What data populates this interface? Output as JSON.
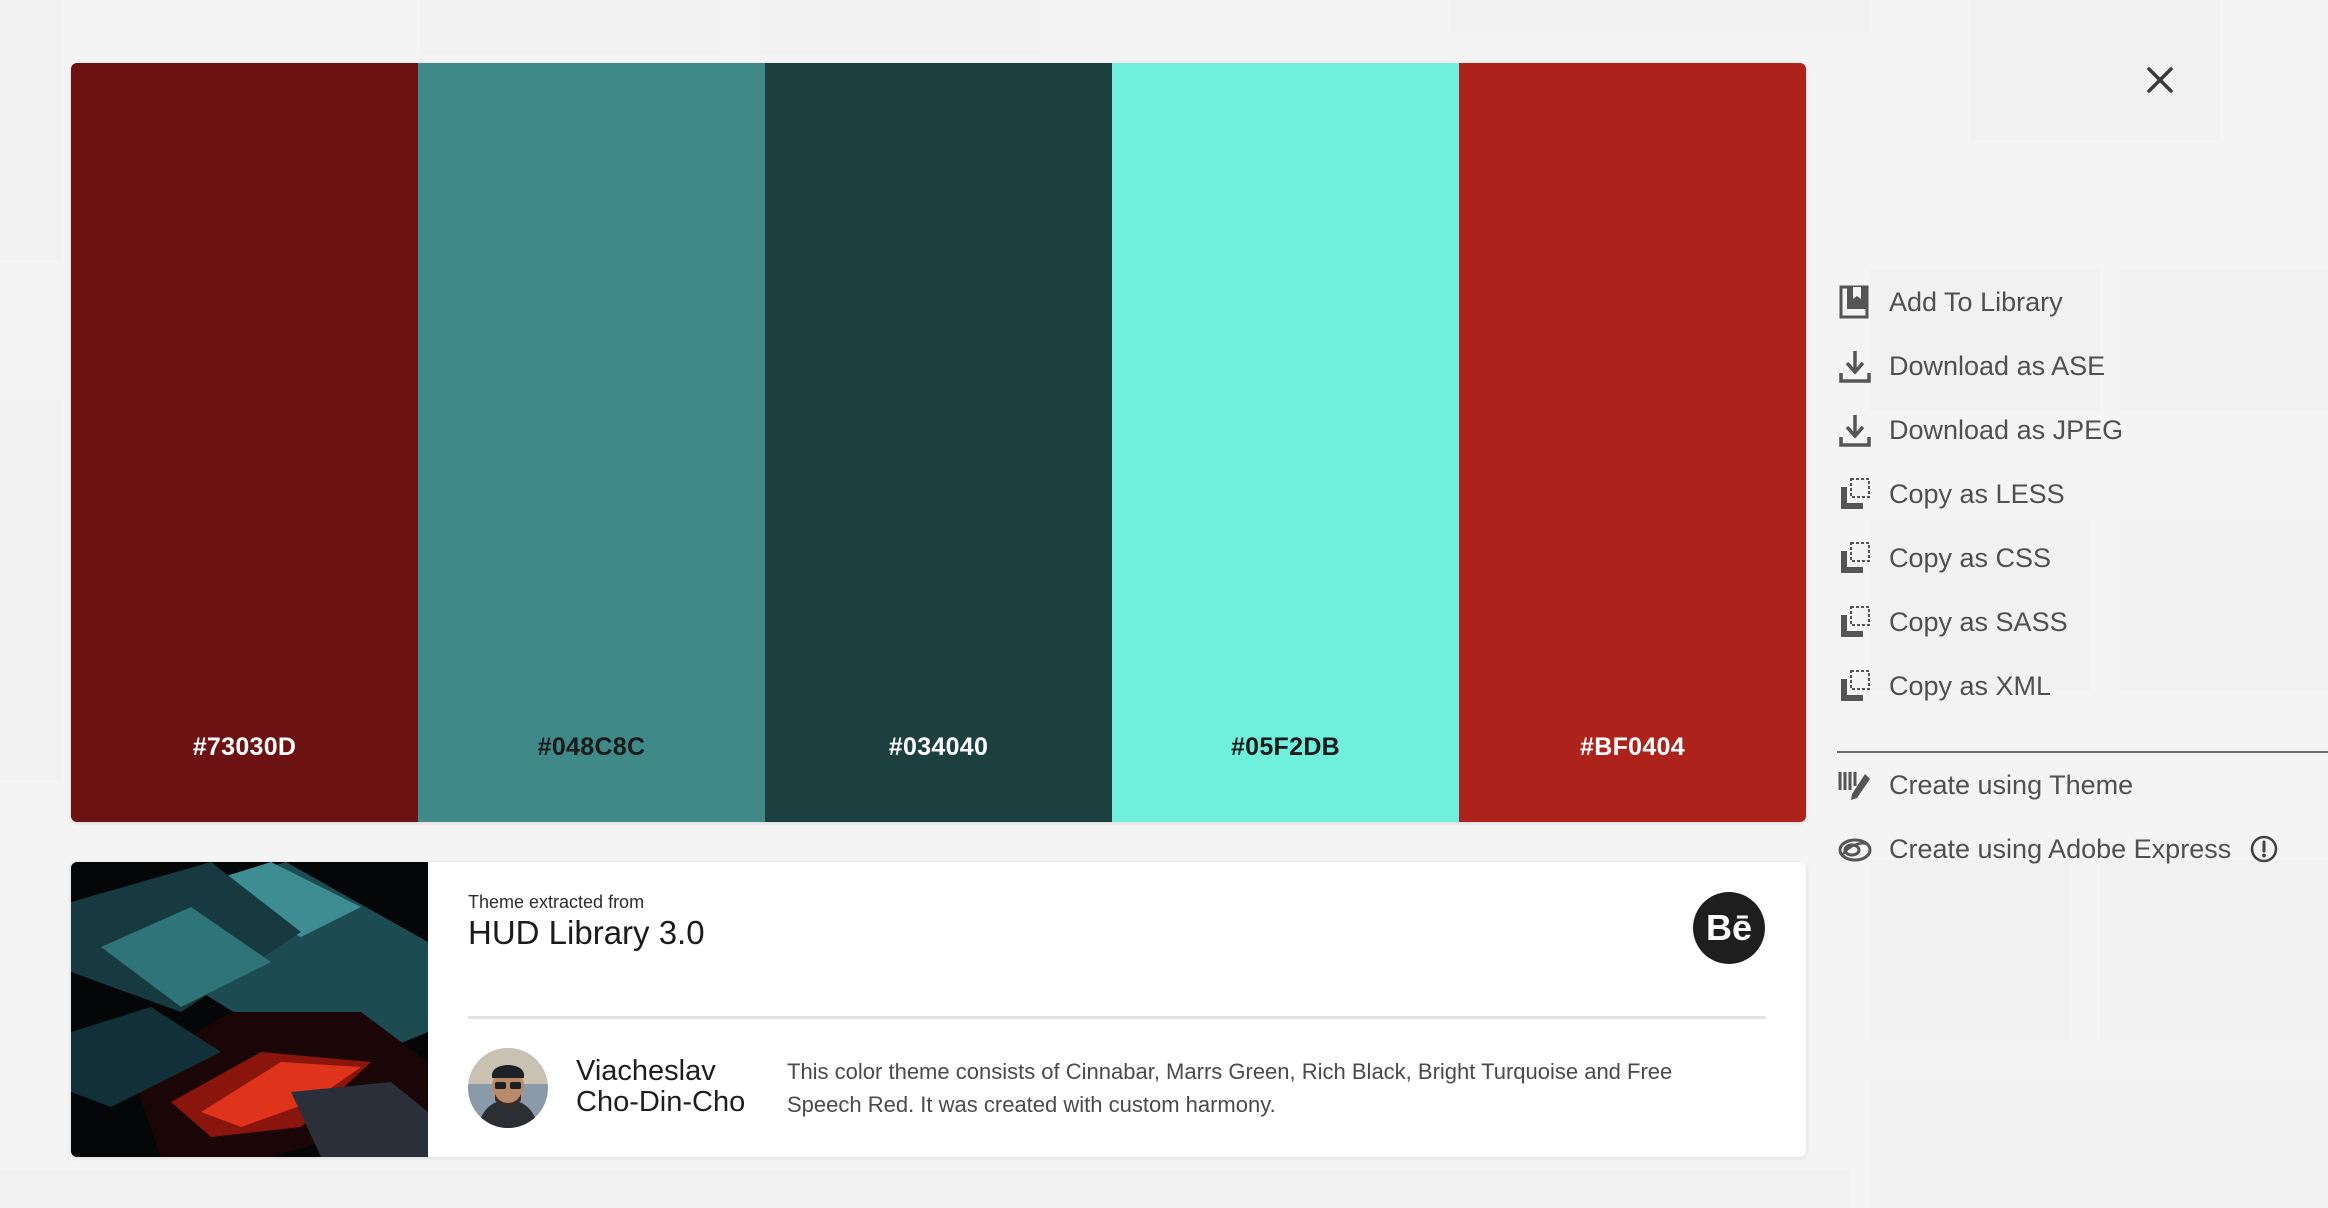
{
  "palette": {
    "swatches": [
      {
        "hex": "#73030D",
        "color": "#6c1212",
        "text_color": "#ffffff"
      },
      {
        "hex": "#048C8C",
        "color": "#3f8989",
        "text_color": "#1a1a1a"
      },
      {
        "hex": "#034040",
        "color": "#1c3f3f",
        "text_color": "#ffffff"
      },
      {
        "hex": "#05F2DB",
        "color": "#6ff0dc",
        "text_color": "#1a1a1a"
      },
      {
        "hex": "#BF0404",
        "color": "#ad231b",
        "text_color": "#ffffff"
      }
    ]
  },
  "close": {
    "icon": "close-icon"
  },
  "actions": {
    "items": [
      {
        "label": "Add To Library",
        "icon": "library-icon"
      },
      {
        "label": "Download as ASE",
        "icon": "download-icon"
      },
      {
        "label": "Download as JPEG",
        "icon": "download-icon"
      },
      {
        "label": "Copy as LESS",
        "icon": "copy-icon"
      },
      {
        "label": "Copy as CSS",
        "icon": "copy-icon"
      },
      {
        "label": "Copy as SASS",
        "icon": "copy-icon"
      },
      {
        "label": "Copy as XML",
        "icon": "copy-icon"
      }
    ],
    "create_items": [
      {
        "label": "Create using Theme",
        "icon": "create-theme-icon"
      },
      {
        "label": "Create using Adobe Express",
        "icon": "adobe-express-icon",
        "info_icon": "info-icon"
      }
    ]
  },
  "source_card": {
    "extracted_label": "Theme extracted from",
    "title": "HUD Library 3.0",
    "behance_label": "Bē",
    "author_first": "Viacheslav",
    "author_last": "Cho-Din-Cho",
    "description": "This color theme consists of Cinnabar, Marrs Green, Rich Black, Bright Turquoise and Free Speech Red. It was created with custom harmony."
  }
}
